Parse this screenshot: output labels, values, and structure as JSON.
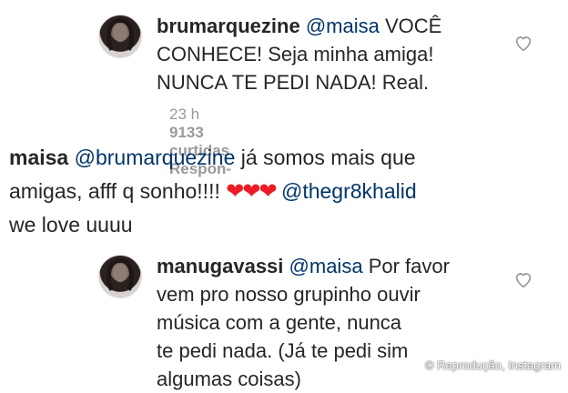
{
  "comments": [
    {
      "username": "brumarquezine",
      "mention": "@maisa",
      "lines": [
        "VOCÊ",
        "CONHECE! Seja minha amiga!",
        "NUNCA TE PEDI NADA! Real."
      ],
      "time": "23 h",
      "likes": "9133 curtidas",
      "reply": "Respon-"
    },
    {
      "username": "maisa",
      "mention": "@brumarquezine",
      "line1": "já somos mais que",
      "line2": "amigas, afff q sonho!!!!",
      "hearts": "❤❤❤",
      "mention2": "@thegr8khalid",
      "line3": "we love uuuu"
    },
    {
      "username": "manugavassi",
      "mention": "@maisa",
      "lines": [
        "Por favor",
        "vem pro nosso grupinho ouvir",
        "música com a gente, nunca",
        "te pedi nada. (Já te pedi sim",
        "algumas coisas)"
      ]
    }
  ],
  "credit": "© Reprodução, Instagram",
  "colors": {
    "mention": "#003569",
    "meta": "#999999",
    "heart": "#ed1c24"
  },
  "icons": [
    "heart-outline-icon"
  ]
}
